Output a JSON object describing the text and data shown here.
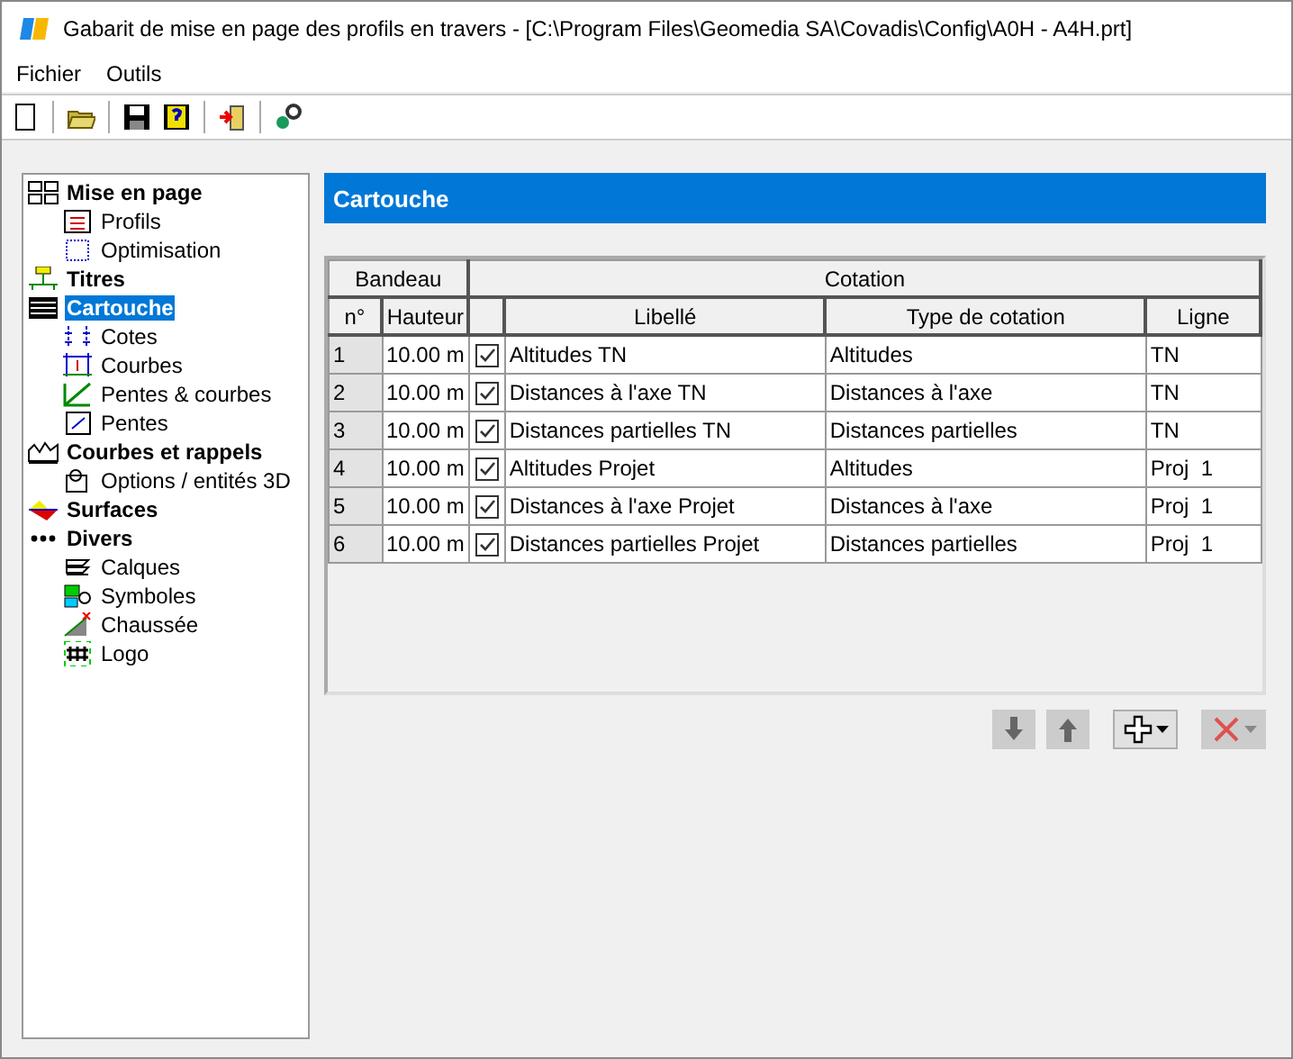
{
  "window": {
    "title": "Gabarit de mise en page des profils en travers - [C:\\Program Files\\Geomedia SA\\Covadis\\Config\\A0H - A4H.prt]"
  },
  "menu": [
    "Fichier",
    "Outils"
  ],
  "tree": [
    {
      "label": "Mise en page",
      "selected": false,
      "children": [
        {
          "label": "Profils",
          "selected": false
        },
        {
          "label": "Optimisation",
          "selected": false
        }
      ]
    },
    {
      "label": "Titres",
      "selected": false
    },
    {
      "label": "Cartouche",
      "selected": true,
      "children": [
        {
          "label": "Cotes",
          "selected": false
        },
        {
          "label": "Courbes",
          "selected": false
        },
        {
          "label": "Pentes & courbes",
          "selected": false
        },
        {
          "label": "Pentes",
          "selected": false
        }
      ]
    },
    {
      "label": "Courbes et rappels",
      "selected": false,
      "children": [
        {
          "label": "Options / entités 3D",
          "selected": false
        }
      ]
    },
    {
      "label": "Surfaces",
      "selected": false
    },
    {
      "label": "Divers",
      "selected": false,
      "children": [
        {
          "label": "Calques",
          "selected": false
        },
        {
          "label": "Symboles",
          "selected": false
        },
        {
          "label": "Chaussée",
          "selected": false
        },
        {
          "label": "Logo",
          "selected": false
        }
      ]
    }
  ],
  "panel": {
    "title": "Cartouche"
  },
  "table": {
    "groups": [
      "Bandeau",
      "Cotation"
    ],
    "columns": [
      "n°",
      "Hauteur",
      "",
      "Libellé",
      "Type de cotation",
      "Ligne"
    ],
    "rows": [
      {
        "n": "1",
        "hauteur": "10.00 m",
        "checked": true,
        "libelle": "Altitudes TN",
        "type": "Altitudes",
        "ligne": "TN"
      },
      {
        "n": "2",
        "hauteur": "10.00 m",
        "checked": true,
        "libelle": "Distances à l'axe TN",
        "type": "Distances à l'axe",
        "ligne": "TN"
      },
      {
        "n": "3",
        "hauteur": "10.00 m",
        "checked": true,
        "libelle": "Distances partielles TN",
        "type": "Distances partielles",
        "ligne": "TN"
      },
      {
        "n": "4",
        "hauteur": "10.00 m",
        "checked": true,
        "libelle": "Altitudes Projet",
        "type": "Altitudes",
        "ligne": "Proj  1"
      },
      {
        "n": "5",
        "hauteur": "10.00 m",
        "checked": true,
        "libelle": "Distances à l'axe Projet",
        "type": "Distances à l'axe",
        "ligne": "Proj  1"
      },
      {
        "n": "6",
        "hauteur": "10.00 m",
        "checked": true,
        "libelle": "Distances partielles Projet",
        "type": "Distances partielles",
        "ligne": "Proj  1"
      }
    ]
  },
  "actions": [
    {
      "kind": "down",
      "disabled": true
    },
    {
      "kind": "up",
      "disabled": true
    },
    {
      "kind": "add",
      "disabled": false
    },
    {
      "kind": "delete",
      "disabled": true
    }
  ]
}
